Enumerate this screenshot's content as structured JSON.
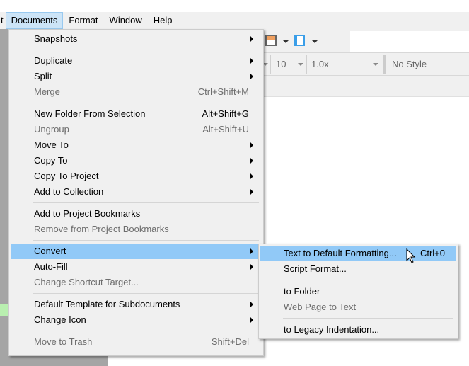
{
  "menubar": {
    "items": [
      {
        "label": "t"
      },
      {
        "label": "Documents"
      },
      {
        "label": "Format"
      },
      {
        "label": "Window"
      },
      {
        "label": "Help"
      }
    ]
  },
  "format_bar": {
    "font_size": "10",
    "line_spacing": "1.0x",
    "style": "No Style"
  },
  "documents_menu": [
    {
      "label": "Snapshots",
      "submenu": true
    },
    {
      "separator": true
    },
    {
      "label": "Duplicate",
      "submenu": true
    },
    {
      "label": "Split",
      "submenu": true
    },
    {
      "label": "Merge",
      "shortcut": "Ctrl+Shift+M",
      "disabled": true
    },
    {
      "separator": true
    },
    {
      "label": "New Folder From Selection",
      "shortcut": "Alt+Shift+G"
    },
    {
      "label": "Ungroup",
      "shortcut": "Alt+Shift+U",
      "disabled": true
    },
    {
      "label": "Move To",
      "submenu": true
    },
    {
      "label": "Copy To",
      "submenu": true
    },
    {
      "label": "Copy To Project",
      "submenu": true
    },
    {
      "label": "Add to Collection",
      "submenu": true
    },
    {
      "separator": true
    },
    {
      "label": "Add to Project Bookmarks"
    },
    {
      "label": "Remove from Project Bookmarks",
      "disabled": true
    },
    {
      "separator": true
    },
    {
      "label": "Convert",
      "submenu": true,
      "highlighted": true
    },
    {
      "label": "Auto-Fill",
      "submenu": true
    },
    {
      "label": "Change Shortcut Target...",
      "disabled": true
    },
    {
      "separator": true
    },
    {
      "label": "Default Template for Subdocuments",
      "submenu": true
    },
    {
      "label": "Change Icon",
      "submenu": true
    },
    {
      "separator": true
    },
    {
      "label": "Move to Trash",
      "shortcut": "Shift+Del",
      "disabled": true
    }
  ],
  "convert_submenu": [
    {
      "label": "Text to Default Formatting...",
      "shortcut": "Ctrl+0",
      "highlighted": true
    },
    {
      "label": "Script Format..."
    },
    {
      "separator": true
    },
    {
      "label": "to Folder"
    },
    {
      "label": "Web Page to Text",
      "disabled": true
    },
    {
      "separator": true
    },
    {
      "label": "to Legacy Indentation..."
    }
  ],
  "colors": {
    "highlight": "#91c9f7",
    "menubar_active": "#cce4f7",
    "menu_bg": "#f0f0f0",
    "disabled_text": "#6d6d6d"
  }
}
